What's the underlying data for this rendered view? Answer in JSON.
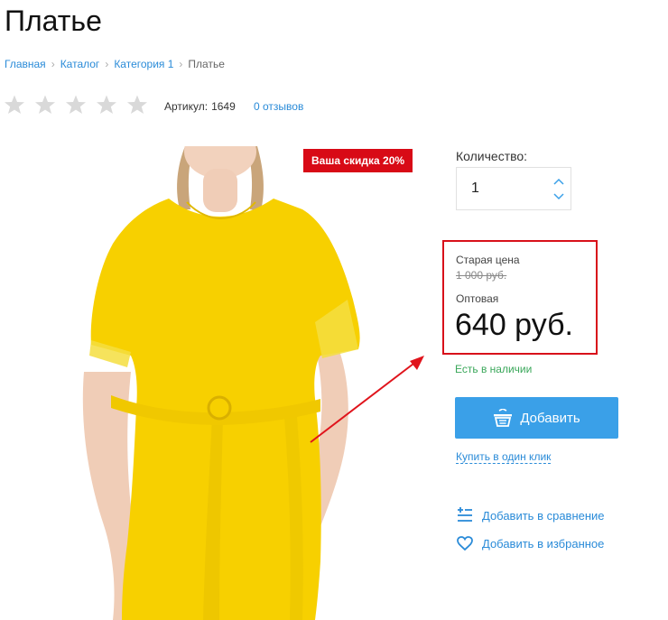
{
  "page": {
    "title": "Платье"
  },
  "breadcrumb": {
    "items": [
      "Главная",
      "Каталог",
      "Категория 1"
    ],
    "current": "Платье"
  },
  "rating": {
    "stars_filled": 0,
    "stars_total": 5
  },
  "article": {
    "label": "Артикул:",
    "value": "1649"
  },
  "reviews": {
    "label": "0 отзывов"
  },
  "discount_badge": {
    "label": "Ваша скидка 20%"
  },
  "quantity": {
    "label": "Количество:",
    "value": "1"
  },
  "pricing": {
    "old_label": "Старая цена",
    "old_price": "1 000 руб.",
    "wholesale_label": "Оптовая",
    "price": "640 руб."
  },
  "stock": {
    "label": "Есть в наличии"
  },
  "actions": {
    "add_label": "Добавить",
    "oneclick_label": "Купить в один клик",
    "compare_label": "Добавить в сравнение",
    "favorite_label": "Добавить в избранное"
  },
  "colors": {
    "link": "#2a8bd8",
    "button": "#3aa0e8",
    "badge": "#d80a16",
    "highlight": "#d8101a",
    "stock": "#3aa75a",
    "dress": "#f7d000"
  },
  "icons": [
    "star-icon",
    "chevron-up-icon",
    "chevron-down-icon",
    "basket-icon",
    "compare-icon",
    "heart-icon"
  ]
}
